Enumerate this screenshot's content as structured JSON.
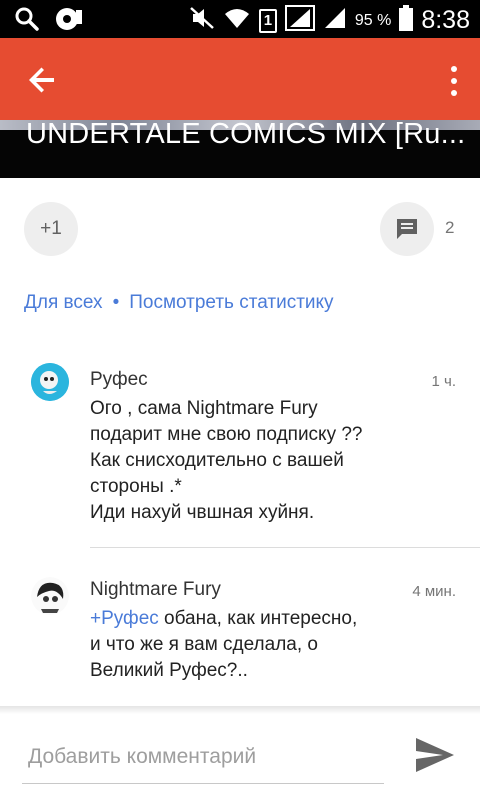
{
  "statusbar": {
    "battery_text": "95 %",
    "time": "8:38",
    "sim_label": "1"
  },
  "banner": {
    "title": "UNDERTALE COMICS MIX [Ru..."
  },
  "actions": {
    "plus_label": "+1",
    "comment_count": "2"
  },
  "links": {
    "audience": "Для всех",
    "stats": "Посмотреть статистику"
  },
  "comments": [
    {
      "author": "Руфес",
      "time": "1 ч.",
      "text": "Ого , сама Nightmare Fury\nподарит мне свою подписку ??\nКак снисходительно с вашей\nстороны .*\nИди нахуй чвшная хуйня."
    },
    {
      "author": "Nightmare Fury",
      "time": "4 мин.",
      "mention": "+Руфес",
      "text": " обана, как интересно,\nи что же я вам сделала, о\nВеликий Руфес?.."
    }
  ],
  "composer": {
    "placeholder": "Добавить комментарий"
  },
  "colors": {
    "appbar": "#e64c31",
    "link": "#4a7bd8"
  }
}
